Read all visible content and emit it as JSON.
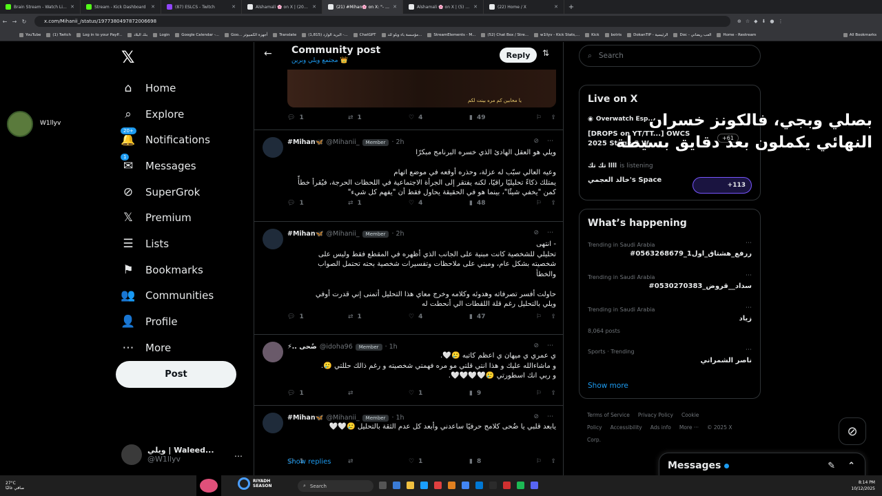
{
  "browser": {
    "tabs": [
      {
        "label": "Brain Stream - Watch Live on K",
        "color": "#53fc18"
      },
      {
        "label": "Stream - Kick Dashboard",
        "color": "#53fc18"
      },
      {
        "label": "(87) ESLCS - Twitch",
        "color": "#9146ff"
      },
      {
        "label": "Alshamali 🌸 on X | ويلي (20)",
        "color": "#000000"
      },
      {
        "label": "(21) #Mihan🌸 on X: \"- 5#",
        "color": "#000000"
      },
      {
        "label": "Alshamali 🌸 on X | ويلي (5)",
        "color": "#000000"
      },
      {
        "label": "(22) Home / X",
        "color": "#000000"
      }
    ],
    "url": "x.com/Mihanii_/status/1977380497872006698",
    "bookmarks": [
      "YouTube",
      "(1) Twitch",
      "Log in to your PayP...",
      "بنك البلاد",
      "Login",
      "Google Calendar -...",
      "Goo... أجهزة الكمبيوتر",
      "Translate",
      "(1,815) البريد الوارد -...",
      "ChatGPT",
      "مؤسسة باء ويلو للد...",
      "StreamElements - M...",
      "(52) Chat Box / Stre...",
      "w1llyv - Kick Stats,...",
      "Kick",
      "botris",
      "DokanTIP - الرئيسية",
      "Doc - العب ريضاني",
      "Home - Restream"
    ],
    "all_bookmarks": "All Bookmarks"
  },
  "left_profile": {
    "name": "W1llyv"
  },
  "sidebar": {
    "items": [
      {
        "label": "Home",
        "icon": "home-icon",
        "glyph": "⌂"
      },
      {
        "label": "Explore",
        "icon": "search-icon",
        "glyph": "⌕"
      },
      {
        "label": "Notifications",
        "icon": "bell-icon",
        "glyph": "🔔",
        "badge": "20+"
      },
      {
        "label": "Messages",
        "icon": "envelope-icon",
        "glyph": "✉",
        "badge": "1"
      },
      {
        "label": "SuperGrok",
        "icon": "grok-icon",
        "glyph": "⊘"
      },
      {
        "label": "Premium",
        "icon": "x-logo-icon",
        "glyph": "𝕏"
      },
      {
        "label": "Lists",
        "icon": "list-icon",
        "glyph": "☰"
      },
      {
        "label": "Bookmarks",
        "icon": "bookmark-icon",
        "glyph": "⚑"
      },
      {
        "label": "Communities",
        "icon": "people-icon",
        "glyph": "👥"
      },
      {
        "label": "Profile",
        "icon": "person-icon",
        "glyph": "👤"
      },
      {
        "label": "More",
        "icon": "more-circle-icon",
        "glyph": "⋯"
      }
    ],
    "post_label": "Post",
    "account": {
      "name": "ويلي | Waleed...",
      "handle": "@W1llyv"
    }
  },
  "header": {
    "title": "Community post",
    "subtitle": "مجتمع ويلي وبرين 👑",
    "reply_label": "Reply"
  },
  "top_media": {
    "caption": "يا محابين كم مره بينت لكم",
    "stats": {
      "reply": "1",
      "repost": "1",
      "like": "4",
      "views": "49"
    }
  },
  "posts": [
    {
      "name": "#Mihan🦋",
      "handle": "@Mihanii_",
      "badge": "Member",
      "time": "· 2h",
      "text": "ويلي هو العقل الهادئ الذي خسره البرنامج مبكرًا\n\nوعيه العالي سبّب له عزلة، وحذره أوقعه في موضع اتهام\nيمتلك ذكاءً تحليليًا راقيًا، لكنه يفتقر إلى الجرأة الاجتماعية في اللحظات الحرجة، فيُقرأ خطأً\nكمن \"يخفي شيئًا\"، بينما هو في الحقيقة يحاول فقط أن \"يفهم كل شيء\"",
      "stats": {
        "reply": "1",
        "repost": "1",
        "like": "4",
        "views": "48"
      }
    },
    {
      "name": "#Mihan🦋",
      "handle": "@Mihanii_",
      "badge": "Member",
      "time": "· 2h",
      "text": "- انتهى\nتحليلي للشخصية كانت مبنية على الجانب الذي أظهره في المقطع فقط وليس على\nشخصيته بشكل عام، ومبني على ملاحظات وتفسيرات شخصية بحته تحتمل الصواب\nوالخطأ\n\nحاولت أفسر تصرفاته وهدوئه وكلامه وخرج معاي هذا التحليل أتمنى إني قدرت أوفي\nويلي بالتحليل رغم قلة اللقطات الي أنحطت له",
      "stats": {
        "reply": "1",
        "repost": "1",
        "like": "4",
        "views": "47"
      }
    },
    {
      "name": "⚡.. ضُحى",
      "handle": "@idoha96",
      "badge": "Member",
      "time": "· 1h",
      "text": "ي عمري ي ميهان ي اعظم كاتبه 🥲🤍.\nو ماشاءالله عليك و هذا انتي قلتي مو مره فهمتي شخصيته و رغم ذالك حللتي 🥲.\nو ربي انك اسطورتي 🥲🤍🤍🤍🤍.",
      "stats": {
        "reply": "1",
        "repost": "",
        "like": "1",
        "views": "9"
      }
    },
    {
      "name": "#Mihan🦋",
      "handle": "@Mihanii_",
      "badge": "Member",
      "time": "· 1h",
      "text": "يابعد قلبي يا ضُحى كلامج حرفيًا ساعدني وأبعد كل عدم الثقة بالتحليل 🥲🤍🤍",
      "stats": {
        "reply": "1",
        "repost": "",
        "like": "1",
        "views": "8"
      }
    }
  ],
  "show_replies": "Show replies",
  "right": {
    "search_placeholder": "Search",
    "live": {
      "title": "Live on X",
      "item1_host": "Overwatch Esp...",
      "item1_title": "[DROPS on YT/TT...] OWCS 2025 Stage 3 W...",
      "item1_count": "+61",
      "item2_host": "اااا تك تك",
      "item2_status": "is listening",
      "item2_title": "خالد العجمي's Space",
      "item2_count": "+113"
    },
    "happening": {
      "title": "What’s happening",
      "trends": [
        {
          "cat": "Trending in Saudi Arabia",
          "title": "#ررفع_هشتاق_اول1_0563268679",
          "posts": ""
        },
        {
          "cat": "Trending in Saudi Arabia",
          "title": "#سداد__قروض_0530270383",
          "posts": ""
        },
        {
          "cat": "Trending in Saudi Arabia",
          "title": "زياد",
          "posts": "8,064 posts"
        },
        {
          "cat": "Sports · Trending",
          "title": "ناصر الشمراني",
          "posts": ""
        }
      ],
      "show_more": "Show more"
    },
    "footer": [
      "Terms of Service",
      "Privacy Policy",
      "Cookie Policy",
      "Accessibility",
      "Ads info",
      "More ···",
      "© 2025 X Corp."
    ],
    "overlay_line1": "بصلي وبجي، فالكونز خسران",
    "overlay_line2": "النهائي يكملون بعد دقايق بسيطة"
  },
  "messages_bar": {
    "label": "Messages"
  },
  "taskbar": {
    "weather_temp": "27°C",
    "weather_desc": "صافي غالبًا",
    "search": "Search",
    "riyadh": "RIYADH SEASON",
    "time": "8:14 PM",
    "date": "10/12/2025"
  }
}
